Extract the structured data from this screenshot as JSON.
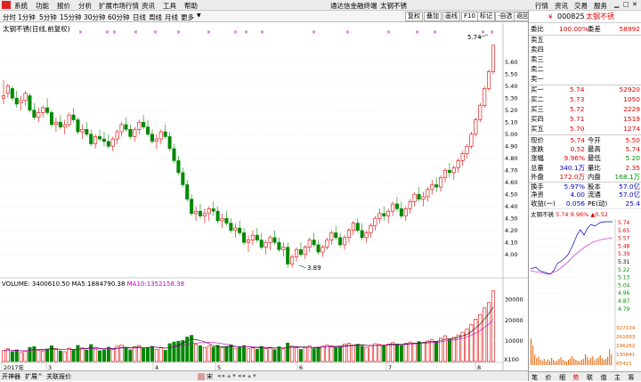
{
  "menubar": {
    "items": [
      "系统",
      "功能",
      "报价",
      "分析",
      "扩展市场行情",
      "资讯",
      "工具",
      "帮助"
    ],
    "center_title": "通达信金融终端",
    "center_stock": "太钢不锈",
    "right_items": [
      "行情",
      "资讯",
      "交易",
      "服务"
    ]
  },
  "toolbar": {
    "periods": [
      "分时",
      "1分钟",
      "5分钟",
      "15分钟",
      "30分钟",
      "60分钟",
      "日线",
      "周线",
      "月线",
      "更多"
    ],
    "active_period": "日线",
    "buttons": [
      "复权",
      "叠加",
      "画线",
      "F10",
      "标记",
      "-自选",
      "返回"
    ]
  },
  "chart": {
    "title": "太钢不锈(日线,前复权)",
    "price_ticks": [
      "5.60",
      "5.50",
      "5.40",
      "5.30",
      "5.20",
      "5.10",
      "5.00",
      "4.90",
      "4.80",
      "4.70",
      "4.60",
      "4.50",
      "4.40",
      "4.30",
      "4.20",
      "4.10",
      "4.00"
    ],
    "high_label": "5.74",
    "low_label": "3.89",
    "volume_header": {
      "prefix": "VOLUME:",
      "vol": "3400610.50",
      "ma5_label": "MA5:",
      "ma5": "1884790.38",
      "ma10_label": "MA10:",
      "ma10": "1352158.38"
    },
    "volume_ticks": [
      "30000",
      "20000",
      "10000"
    ],
    "volume_unit": "X100",
    "date_labels": [
      "2017年",
      "3",
      "4",
      "5",
      "6",
      "7",
      "8"
    ],
    "colors": {
      "up": "#e00000",
      "down": "#008800",
      "ma5": "#000000",
      "ma10": "#c000c0"
    }
  },
  "chart_data": {
    "type": "candlestick",
    "title": "太钢不锈(日线,前复权)",
    "ohlc": [
      [
        5.3,
        5.45,
        5.25,
        5.32
      ],
      [
        5.34,
        5.42,
        5.3,
        5.4
      ],
      [
        5.38,
        5.4,
        5.28,
        5.3
      ],
      [
        5.3,
        5.36,
        5.22,
        5.25
      ],
      [
        5.26,
        5.32,
        5.2,
        5.28
      ],
      [
        5.28,
        5.36,
        5.24,
        5.34
      ],
      [
        5.32,
        5.34,
        5.18,
        5.2
      ],
      [
        5.2,
        5.26,
        5.12,
        5.14
      ],
      [
        5.14,
        5.22,
        5.1,
        5.18
      ],
      [
        5.18,
        5.24,
        5.14,
        5.22
      ],
      [
        5.22,
        5.3,
        5.16,
        5.18
      ],
      [
        5.18,
        5.2,
        5.06,
        5.08
      ],
      [
        5.08,
        5.14,
        5.02,
        5.1
      ],
      [
        5.1,
        5.16,
        5.04,
        5.06
      ],
      [
        5.06,
        5.12,
        5.0,
        5.08
      ],
      [
        5.08,
        5.18,
        5.06,
        5.16
      ],
      [
        5.16,
        5.22,
        5.1,
        5.12
      ],
      [
        5.12,
        5.14,
        5.0,
        5.02
      ],
      [
        5.02,
        5.08,
        4.96,
        5.04
      ],
      [
        5.04,
        5.1,
        4.98,
        5.0
      ],
      [
        5.0,
        5.04,
        4.9,
        4.92
      ],
      [
        4.92,
        5.0,
        4.88,
        4.98
      ],
      [
        4.98,
        5.04,
        4.94,
        4.96
      ],
      [
        4.96,
        5.02,
        4.9,
        4.94
      ],
      [
        4.94,
        5.0,
        4.88,
        4.9
      ],
      [
        4.9,
        4.98,
        4.86,
        4.96
      ],
      [
        4.96,
        5.04,
        4.92,
        5.02
      ],
      [
        5.02,
        5.1,
        4.98,
        5.08
      ],
      [
        5.08,
        5.14,
        5.02,
        5.04
      ],
      [
        5.04,
        5.08,
        4.96,
        4.98
      ],
      [
        4.98,
        5.06,
        4.94,
        5.04
      ],
      [
        5.04,
        5.12,
        5.0,
        5.1
      ],
      [
        5.1,
        5.16,
        5.04,
        5.06
      ],
      [
        5.06,
        5.12,
        4.98,
        5.0
      ],
      [
        5.0,
        5.04,
        4.92,
        4.94
      ],
      [
        4.94,
        5.0,
        4.88,
        4.96
      ],
      [
        4.96,
        5.04,
        4.92,
        5.02
      ],
      [
        5.02,
        5.08,
        4.96,
        4.98
      ],
      [
        4.98,
        5.02,
        4.86,
        4.88
      ],
      [
        4.88,
        4.92,
        4.76,
        4.78
      ],
      [
        4.78,
        4.82,
        4.66,
        4.68
      ],
      [
        4.68,
        4.72,
        4.56,
        4.58
      ],
      [
        4.58,
        4.62,
        4.44,
        4.46
      ],
      [
        4.46,
        4.5,
        4.32,
        4.34
      ],
      [
        4.34,
        4.4,
        4.28,
        4.36
      ],
      [
        4.36,
        4.42,
        4.3,
        4.32
      ],
      [
        4.32,
        4.38,
        4.26,
        4.34
      ],
      [
        4.34,
        4.4,
        4.28,
        4.38
      ],
      [
        4.38,
        4.44,
        4.32,
        4.36
      ],
      [
        4.36,
        4.4,
        4.26,
        4.28
      ],
      [
        4.28,
        4.34,
        4.22,
        4.3
      ],
      [
        4.3,
        4.36,
        4.24,
        4.26
      ],
      [
        4.26,
        4.3,
        4.18,
        4.2
      ],
      [
        4.2,
        4.26,
        4.14,
        4.22
      ],
      [
        4.22,
        4.28,
        4.16,
        4.18
      ],
      [
        4.18,
        4.22,
        4.08,
        4.1
      ],
      [
        4.1,
        4.16,
        4.02,
        4.12
      ],
      [
        4.12,
        4.2,
        4.08,
        4.16
      ],
      [
        4.16,
        4.22,
        4.1,
        4.12
      ],
      [
        4.12,
        4.18,
        4.04,
        4.06
      ],
      [
        4.06,
        4.12,
        4.0,
        4.1
      ],
      [
        4.1,
        4.16,
        4.04,
        4.14
      ],
      [
        4.14,
        4.2,
        4.08,
        4.1
      ],
      [
        4.1,
        4.14,
        4.02,
        4.04
      ],
      [
        4.04,
        4.1,
        3.98,
        4.06
      ],
      [
        4.06,
        4.1,
        3.89,
        3.92
      ],
      [
        3.92,
        4.0,
        3.89,
        3.98
      ],
      [
        3.98,
        4.06,
        3.94,
        4.04
      ],
      [
        4.04,
        4.1,
        3.98,
        4.0
      ],
      [
        4.0,
        4.08,
        3.96,
        4.06
      ],
      [
        4.06,
        4.14,
        4.02,
        4.12
      ],
      [
        4.12,
        4.18,
        4.06,
        4.08
      ],
      [
        4.08,
        4.12,
        4.0,
        4.02
      ],
      [
        4.02,
        4.08,
        3.98,
        4.06
      ],
      [
        4.06,
        4.14,
        4.04,
        4.12
      ],
      [
        4.12,
        4.2,
        4.08,
        4.18
      ],
      [
        4.18,
        4.24,
        4.12,
        4.14
      ],
      [
        4.14,
        4.18,
        4.06,
        4.08
      ],
      [
        4.08,
        4.16,
        4.04,
        4.14
      ],
      [
        4.14,
        4.22,
        4.1,
        4.2
      ],
      [
        4.2,
        4.28,
        4.16,
        4.26
      ],
      [
        4.26,
        4.3,
        4.18,
        4.2
      ],
      [
        4.2,
        4.26,
        4.12,
        4.14
      ],
      [
        4.14,
        4.2,
        4.1,
        4.18
      ],
      [
        4.18,
        4.26,
        4.14,
        4.24
      ],
      [
        4.24,
        4.32,
        4.2,
        4.3
      ],
      [
        4.3,
        4.38,
        4.26,
        4.34
      ],
      [
        4.34,
        4.4,
        4.28,
        4.32
      ],
      [
        4.32,
        4.38,
        4.26,
        4.36
      ],
      [
        4.36,
        4.44,
        4.32,
        4.42
      ],
      [
        4.42,
        4.48,
        4.36,
        4.38
      ],
      [
        4.38,
        4.44,
        4.3,
        4.32
      ],
      [
        4.32,
        4.4,
        4.28,
        4.38
      ],
      [
        4.38,
        4.46,
        4.34,
        4.44
      ],
      [
        4.44,
        4.52,
        4.4,
        4.5
      ],
      [
        4.5,
        4.56,
        4.44,
        4.46
      ],
      [
        4.46,
        4.52,
        4.4,
        4.48
      ],
      [
        4.48,
        4.56,
        4.44,
        4.54
      ],
      [
        4.54,
        4.62,
        4.5,
        4.58
      ],
      [
        4.58,
        4.64,
        4.52,
        4.56
      ],
      [
        4.56,
        4.66,
        4.52,
        4.64
      ],
      [
        4.64,
        4.72,
        4.6,
        4.7
      ],
      [
        4.7,
        4.76,
        4.64,
        4.68
      ],
      [
        4.68,
        4.74,
        4.62,
        4.72
      ],
      [
        4.72,
        4.8,
        4.68,
        4.78
      ],
      [
        4.78,
        4.86,
        4.74,
        4.84
      ],
      [
        4.84,
        4.92,
        4.8,
        4.9
      ],
      [
        4.9,
        5.02,
        4.88,
        5.0
      ],
      [
        5.0,
        5.14,
        4.98,
        5.12
      ],
      [
        5.12,
        5.26,
        5.1,
        5.24
      ],
      [
        5.24,
        5.4,
        5.22,
        5.38
      ],
      [
        5.38,
        5.54,
        5.36,
        5.52
      ],
      [
        5.52,
        5.74,
        5.5,
        5.74
      ]
    ],
    "volume": [
      5200,
      6100,
      4800,
      5600,
      4300,
      5000,
      6800,
      7200,
      5400,
      4900,
      5800,
      7600,
      6200,
      5100,
      4700,
      6400,
      5300,
      7800,
      6600,
      5500,
      8200,
      6000,
      5200,
      5700,
      6900,
      5900,
      7400,
      8000,
      6300,
      5600,
      7100,
      7700,
      6400,
      6800,
      7300,
      5800,
      6600,
      5400,
      8600,
      9400,
      9800,
      10200,
      11800,
      12600,
      8400,
      7600,
      6800,
      7400,
      6900,
      7800,
      6700,
      7200,
      8100,
      6400,
      6900,
      7700,
      6100,
      6600,
      5900,
      7300,
      6200,
      6800,
      5700,
      7100,
      6300,
      8900,
      7400,
      6600,
      5800,
      6700,
      7500,
      6200,
      6900,
      7400,
      8000,
      7600,
      6800,
      7100,
      8400,
      8800,
      7900,
      8300,
      7300,
      6800,
      7800,
      8600,
      8200,
      7600,
      8400,
      9100,
      8300,
      7700,
      8800,
      9400,
      8900,
      9600,
      9100,
      9900,
      10400,
      9700,
      11200,
      12400,
      10800,
      11600,
      12800,
      14100,
      15600,
      17800,
      20400,
      22600,
      25800,
      28400,
      34006
    ],
    "ma5": [
      5.3,
      5.32,
      5.33,
      5.32,
      5.31,
      5.31,
      5.29,
      5.25,
      5.23,
      5.22,
      5.18,
      5.16,
      5.14,
      5.12,
      5.1,
      5.1,
      5.1,
      5.08,
      5.07,
      5.05,
      5.01,
      4.98,
      4.97,
      4.96,
      4.94,
      4.95,
      4.96,
      4.98,
      5.0,
      5.02,
      5.03,
      5.05,
      5.06,
      5.04,
      5.03,
      5.01,
      4.99,
      4.98,
      4.96,
      4.92,
      4.87,
      4.78,
      4.68,
      4.57,
      4.48,
      4.41,
      4.36,
      4.35,
      4.35,
      4.34,
      4.33,
      4.31,
      4.28,
      4.25,
      4.23,
      4.18,
      4.16,
      4.14,
      4.13,
      4.11,
      4.11,
      4.11,
      4.1,
      4.09,
      4.07,
      4.05,
      4.02,
      4.0,
      3.99,
      4.0,
      4.04,
      4.06,
      4.06,
      4.07,
      4.08,
      4.1,
      4.11,
      4.12,
      4.13,
      4.15,
      4.17,
      4.18,
      4.18,
      4.19,
      4.2,
      4.22,
      4.26,
      4.29,
      4.31,
      4.35,
      4.37,
      4.38,
      4.38,
      4.39,
      4.41,
      4.43,
      4.45,
      4.47,
      4.51,
      4.52,
      4.56,
      4.61,
      4.63,
      4.66,
      4.7,
      4.74,
      4.78,
      4.84,
      4.93,
      5.02,
      5.13,
      5.23,
      5.4
    ],
    "ma10": [
      5.3,
      5.31,
      5.32,
      5.32,
      5.32,
      5.31,
      5.3,
      5.29,
      5.28,
      5.26,
      5.23,
      5.2,
      5.18,
      5.16,
      5.14,
      5.12,
      5.11,
      5.1,
      5.08,
      5.07,
      5.05,
      5.03,
      5.02,
      5.0,
      4.99,
      4.98,
      4.97,
      4.97,
      4.97,
      4.97,
      4.98,
      4.99,
      5.0,
      5.0,
      5.01,
      5.01,
      5.02,
      5.01,
      5.0,
      4.98,
      4.95,
      4.91,
      4.85,
      4.78,
      4.71,
      4.63,
      4.56,
      4.5,
      4.45,
      4.4,
      4.37,
      4.34,
      4.31,
      4.29,
      4.28,
      4.25,
      4.23,
      4.21,
      4.19,
      4.17,
      4.15,
      4.13,
      4.12,
      4.11,
      4.1,
      4.08,
      4.07,
      4.06,
      4.05,
      4.05,
      4.05,
      4.05,
      4.05,
      4.05,
      4.06,
      4.07,
      4.08,
      4.09,
      4.1,
      4.11,
      4.13,
      4.14,
      4.15,
      4.16,
      4.17,
      4.19,
      4.2,
      4.22,
      4.24,
      4.26,
      4.28,
      4.3,
      4.32,
      4.34,
      4.36,
      4.38,
      4.4,
      4.42,
      4.44,
      4.46,
      4.48,
      4.51,
      4.54,
      4.57,
      4.6,
      4.64,
      4.68,
      4.72,
      4.77,
      4.83,
      4.9,
      4.98,
      5.07
    ],
    "ylim": [
      3.85,
      5.82
    ],
    "vol_ylim": [
      0,
      36000
    ],
    "dates": [
      "2017年",
      "3",
      "4",
      "5",
      "6",
      "7",
      "8"
    ]
  },
  "quote": {
    "code": "000825",
    "name": "太钢不锈",
    "weibi_label": "委比",
    "weibi": "100.00%",
    "weicha_label": "委差",
    "weicha": "58992",
    "sell_labels": [
      "卖五",
      "卖四",
      "卖三",
      "卖二",
      "卖一"
    ],
    "buys": [
      {
        "label": "买一",
        "price": "5.74",
        "vol": "52920"
      },
      {
        "label": "买二",
        "price": "5.73",
        "vol": "1050"
      },
      {
        "label": "买三",
        "price": "5.72",
        "vol": "2229"
      },
      {
        "label": "买四",
        "price": "5.71",
        "vol": "1519"
      },
      {
        "label": "买五",
        "price": "5.70",
        "vol": "1274"
      }
    ],
    "stats": [
      {
        "l1": "现价",
        "v1": "5.74",
        "l2": "今开",
        "v2": "5.50",
        "c1": "red",
        "c2": "red"
      },
      {
        "l1": "涨跌",
        "v1": "0.52",
        "l2": "最高",
        "v2": "5.74",
        "c1": "red",
        "c2": "red"
      },
      {
        "l1": "涨幅",
        "v1": "9.96%",
        "l2": "最低",
        "v2": "5.20",
        "c1": "red",
        "c2": "grn"
      },
      {
        "l1": "总量",
        "v1": "340.1万",
        "l2": "量比",
        "v2": "2.35",
        "c1": "blu",
        "c2": "red"
      },
      {
        "l1": "外盘",
        "v1": "172.0万",
        "l2": "内盘",
        "v2": "168.1万",
        "c1": "red",
        "c2": "grn"
      },
      {
        "l1": "换手",
        "v1": "5.97%",
        "l2": "股本",
        "v2": "57.0亿",
        "c1": "blu",
        "c2": "blu"
      },
      {
        "l1": "净资",
        "v1": "4.00",
        "l2": "流通",
        "v2": "57.0亿",
        "c1": "blu",
        "c2": "blu"
      },
      {
        "l1": "收益(一)",
        "v1": "0.056",
        "l2": "PE(动)",
        "v2": "25.4",
        "c1": "blu",
        "c2": "blu"
      }
    ]
  },
  "mini": {
    "header_name": "太钢不锈",
    "header_price": "5.74",
    "header_pct": "9.96%",
    "header_chg": "▲0.52",
    "price_ticks": [
      "5.74",
      "5.65",
      "5.57",
      "5.48",
      "5.39",
      "5.31",
      "5.22",
      "5.13",
      "5.04",
      "4.96",
      "4.87",
      "4.79"
    ],
    "vol_ticks": [
      "327104",
      "261683",
      "196262",
      "130841",
      "65421"
    ],
    "tabs": [
      "笔",
      "价",
      "细",
      "势",
      "联",
      "值",
      "主",
      "筹"
    ]
  },
  "bottom": {
    "items": [
      "开神器",
      "扩展^",
      "关联报价"
    ],
    "scroll_label": "宋",
    "active_tab": "势"
  }
}
